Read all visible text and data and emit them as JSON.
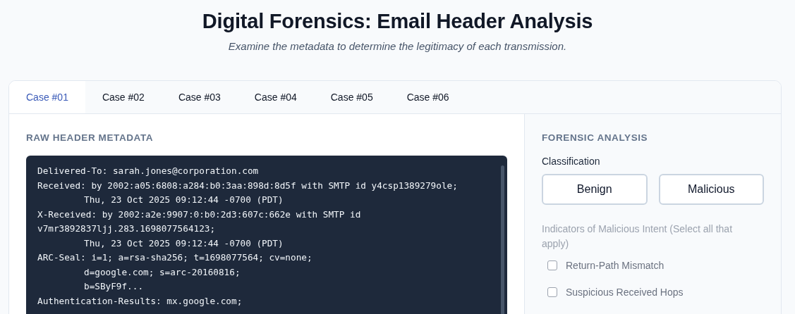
{
  "header": {
    "title": "Digital Forensics: Email Header Analysis",
    "subtitle": "Examine the metadata to determine the legitimacy of each transmission."
  },
  "tabs": [
    {
      "label": "Case #01",
      "selected": true
    },
    {
      "label": "Case #02",
      "selected": false
    },
    {
      "label": "Case #03",
      "selected": false
    },
    {
      "label": "Case #04",
      "selected": false
    },
    {
      "label": "Case #05",
      "selected": false
    },
    {
      "label": "Case #06",
      "selected": false
    }
  ],
  "raw_header": {
    "heading": "RAW HEADER METADATA",
    "lines": [
      {
        "text": "Delivered-To: sarah.jones@corporation.com",
        "continued": false
      },
      {
        "text": "Received: by 2002:a05:6808:a284:b0:3aa:898d:8d5f with SMTP id y4csp1389279ole;",
        "continued": false
      },
      {
        "text": "Thu, 23 Oct 2025 09:12:44 -0700 (PDT)",
        "continued": true
      },
      {
        "text": "X-Received: by 2002:a2e:9907:0:b0:2d3:607c:662e with SMTP id",
        "continued": false
      },
      {
        "text": "v7mr3892837ljj.283.1698077564123;",
        "continued": false
      },
      {
        "text": "Thu, 23 Oct 2025 09:12:44 -0700 (PDT)",
        "continued": true
      },
      {
        "text": "ARC-Seal: i=1; a=rsa-sha256; t=1698077564; cv=none;",
        "continued": false
      },
      {
        "text": "d=google.com; s=arc-20160816;",
        "continued": true
      },
      {
        "text": "b=SByF9f...",
        "continued": true
      },
      {
        "text": "Authentication-Results: mx.google.com;",
        "continued": false
      }
    ]
  },
  "analysis": {
    "heading": "FORENSIC ANALYSIS",
    "classification_label": "Classification",
    "classification_options": [
      {
        "label": "Benign",
        "selected": false
      },
      {
        "label": "Malicious",
        "selected": false
      }
    ],
    "indicators": {
      "label": "Indicators of Malicious Intent (Select all that apply)",
      "disabled": true,
      "items": [
        {
          "label": "Return-Path Mismatch",
          "checked": false
        },
        {
          "label": "Suspicious Received Hops",
          "checked": false
        }
      ]
    }
  }
}
